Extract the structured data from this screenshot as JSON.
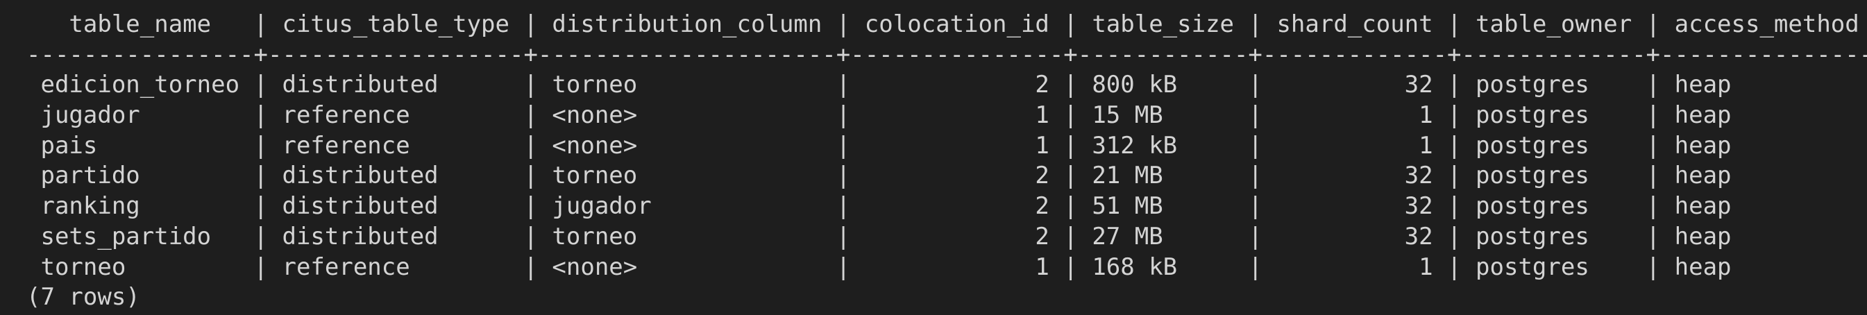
{
  "terminal": {
    "columns": [
      {
        "key": "table_name",
        "label": "table_name",
        "width": 16,
        "align": "center"
      },
      {
        "key": "citus_table_type",
        "label": "citus_table_type",
        "width": 18,
        "align": "center"
      },
      {
        "key": "distribution_column",
        "label": "distribution_column",
        "width": 21,
        "align": "center"
      },
      {
        "key": "colocation_id",
        "label": "colocation_id",
        "width": 15,
        "align": "center"
      },
      {
        "key": "table_size",
        "label": "table_size",
        "width": 12,
        "align": "center"
      },
      {
        "key": "shard_count",
        "label": "shard_count",
        "width": 13,
        "align": "center"
      },
      {
        "key": "table_owner",
        "label": "table_owner",
        "width": 13,
        "align": "center"
      },
      {
        "key": "access_method",
        "label": "access_method",
        "width": 15,
        "align": "center"
      }
    ],
    "rows": [
      {
        "table_name": "edicion_torneo",
        "citus_table_type": "distributed",
        "distribution_column": "torneo",
        "colocation_id": "2",
        "table_size": "800 kB",
        "shard_count": "32",
        "table_owner": "postgres",
        "access_method": "heap"
      },
      {
        "table_name": "jugador",
        "citus_table_type": "reference",
        "distribution_column": "<none>",
        "colocation_id": "1",
        "table_size": "15 MB",
        "shard_count": "1",
        "table_owner": "postgres",
        "access_method": "heap"
      },
      {
        "table_name": "pais",
        "citus_table_type": "reference",
        "distribution_column": "<none>",
        "colocation_id": "1",
        "table_size": "312 kB",
        "shard_count": "1",
        "table_owner": "postgres",
        "access_method": "heap"
      },
      {
        "table_name": "partido",
        "citus_table_type": "distributed",
        "distribution_column": "torneo",
        "colocation_id": "2",
        "table_size": "21 MB",
        "shard_count": "32",
        "table_owner": "postgres",
        "access_method": "heap"
      },
      {
        "table_name": "ranking",
        "citus_table_type": "distributed",
        "distribution_column": "jugador",
        "colocation_id": "2",
        "table_size": "51 MB",
        "shard_count": "32",
        "table_owner": "postgres",
        "access_method": "heap"
      },
      {
        "table_name": "sets_partido",
        "citus_table_type": "distributed",
        "distribution_column": "torneo",
        "colocation_id": "2",
        "table_size": "27 MB",
        "shard_count": "32",
        "table_owner": "postgres",
        "access_method": "heap"
      },
      {
        "table_name": "torneo",
        "citus_table_type": "reference",
        "distribution_column": "<none>",
        "colocation_id": "1",
        "table_size": "168 kB",
        "shard_count": "1",
        "table_owner": "postgres",
        "access_method": "heap"
      }
    ],
    "numeric_columns": [
      "colocation_id",
      "shard_count"
    ],
    "row_count_text": "(7 rows)",
    "colors": {
      "background": "#1e1e1e",
      "text": "#d4d4d4"
    }
  }
}
